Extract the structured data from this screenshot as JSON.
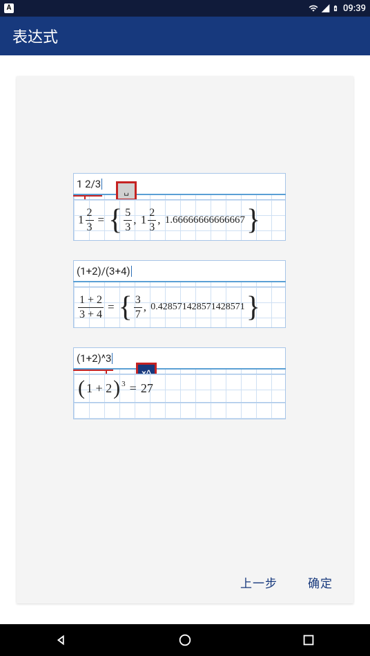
{
  "status": {
    "time": "09:39"
  },
  "appbar": {
    "title": "表达式"
  },
  "examples": {
    "a": {
      "input": "1 2/3",
      "int": "1",
      "f1n": "2",
      "f1d": "3",
      "s1n": "5",
      "s1d": "3",
      "s2i": "1",
      "s2n": "2",
      "s2d": "3",
      "dec": "1.66666666666667",
      "hint": "␣"
    },
    "b": {
      "input": "(1+2)/(3+4)",
      "f1n": "1 + 2",
      "f1d": "3 + 4",
      "s1n": "3",
      "s1d": "7",
      "dec": "0.428571428571428571"
    },
    "c": {
      "input": "(1+2)^3",
      "base": "1 + 2",
      "exp": "3",
      "result": "27",
      "hint": "x^"
    }
  },
  "footer": {
    "prev": "上一步",
    "ok": "确定"
  }
}
